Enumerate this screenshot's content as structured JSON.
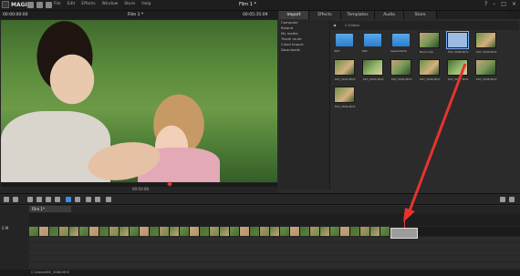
{
  "app": {
    "logo": "MAGIX",
    "project_title": "Film 1 *"
  },
  "menu": [
    "File",
    "Edit",
    "Effects",
    "Window",
    "Store",
    "Help"
  ],
  "preview": {
    "time_left": "00:00:00:00",
    "time_right": "00:05:35:09",
    "scrub_time": "00:03:08"
  },
  "media_pool": {
    "tabs": [
      "Import",
      "Effects",
      "Templates",
      "Audio",
      "Store"
    ],
    "sidebar": [
      "Computer",
      "Roland",
      "My media",
      "Travel route",
      "Cloud Import",
      "Downloads"
    ],
    "path": "C:\\Video",
    "items": [
      {
        "label": "360°",
        "kind": "folder"
      },
      {
        "label": "MRI",
        "kind": "folder"
      },
      {
        "label": "SpeedoRide",
        "kind": "folder"
      },
      {
        "label": "Berlin-trip",
        "kind": "video"
      },
      {
        "label": "MVI_3088.MOV",
        "kind": "video",
        "selected": true
      },
      {
        "label": "MVI_3090.MOV",
        "kind": "video"
      },
      {
        "label": "MVI_3093.MOV",
        "kind": "video"
      },
      {
        "label": "MVI_3094.MOV",
        "kind": "video"
      },
      {
        "label": "MVI_3095.MOV",
        "kind": "video"
      },
      {
        "label": "MVI_3096.MOV",
        "kind": "video"
      },
      {
        "label": "MVI_3097.MOV",
        "kind": "video"
      },
      {
        "label": "MVI_3098.MOV",
        "kind": "video"
      },
      {
        "label": "MVI_3099.MOV",
        "kind": "video"
      }
    ]
  },
  "timeline": {
    "tab": "Film 1*",
    "track_label": "S M",
    "status": "C:\\Video\\MVI_3088.MOV"
  },
  "colors": {
    "accent": "#e53a3a",
    "folder": "#3b8fe0",
    "selection": "#7fb3ff"
  }
}
